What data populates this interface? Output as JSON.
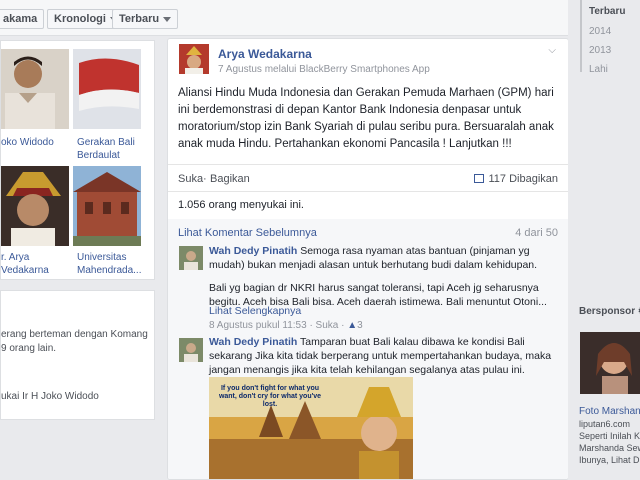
{
  "filters": {
    "item1": "akama",
    "item2": "Kronologi",
    "item3": "Terbaru"
  },
  "left_grid": {
    "tiles": [
      {
        "label": "oko Widodo"
      },
      {
        "label1": "Gerakan Bali",
        "label2": "Berdaulat"
      },
      {
        "label1": "r. Arya",
        "label2": "Vedakarna"
      },
      {
        "label1": "Universitas",
        "label2": "Mahendrada..."
      }
    ]
  },
  "left_card2": {
    "line1": "erang berteman dengan Komang",
    "line2": "9 orang lain.",
    "line3": "ukai Ir H Joko Widodo"
  },
  "post": {
    "author": "Arya Wedakarna",
    "meta": "7 Agustus melalui BlackBerry Smartphones App",
    "text": "Aliansi Hindu Muda Indonesia dan Gerakan Pemuda Marhaen (GPM) hari ini berdemonstrasi di depan Kantor Bank Indonesia denpasar untuk moratorium/stop izin Bank Syariah di pulau seribu pura. Bersuaralah anak anak muda Hindu. Pertahankan ekonomi Pancasila ! Lanjutkan !!!",
    "actions": {
      "like": "Suka",
      "separator": "·",
      "share": "Bagikan"
    },
    "shares": "117 Dibagikan",
    "likes": "1.056 orang menyukai ini.",
    "prev_comments": "Lihat Komentar Sebelumnya",
    "comment_count": "4 dari 50"
  },
  "comments": [
    {
      "name": "Wah Dedy Pinatih",
      "text": "Semoga rasa nyaman atas bantuan (pinjaman yg mudah) bukan menjadi alasan untuk berhutang budi dalam kehidupan.",
      "text2": "Bali yg bagian dr NKRI harus sangat toleransi, tapi Aceh jg seharusnya begitu. Aceh bisa Bali bisa. Aceh daerah istimewa. Bali menuntut Otoni...",
      "see_more": "Lihat Selengkapnya",
      "meta": "8 Agustus pukul 11:53 · Suka · ",
      "likes": "3"
    },
    {
      "name": "Wah Dedy Pinatih",
      "text": "Tamparan buat Bali kalau dibawa ke kondisi Bali sekarang Jika kita tidak berperang untuk mempertahankan budaya, maka jangan menangis jika kita telah kehilangan segalanya atas pulau ini.",
      "image_text": "If you don't fight for what you want, don't cry for what you've lost."
    }
  ],
  "timeline_years": [
    "Terbaru",
    "2014",
    "2013",
    "Lahi"
  ],
  "sponsored": {
    "title": "Bersponsor",
    "ad_title": "Foto Marshane",
    "ad_domain": "liputan6.com",
    "ad_line1": "Seperti Inilah Ka",
    "ad_line2": "Marshanda Sewa",
    "ad_line3": "Ibunya, Lihat Dis"
  },
  "colors": {
    "link": "#3b5998",
    "meta": "#90949c",
    "bg": "#e9eaed"
  }
}
